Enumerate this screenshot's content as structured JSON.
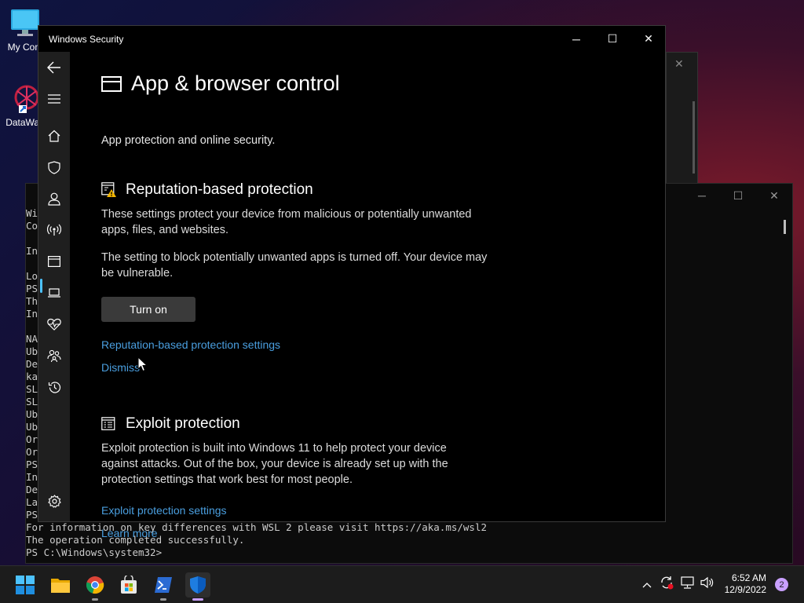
{
  "desktop": {
    "icons": [
      {
        "label": "My Com",
        "icon": "monitor-icon"
      },
      {
        "label": "DataWag",
        "icon": "datawag-icon"
      }
    ]
  },
  "powershell": {
    "lines": [
      "Wi",
      "Co",
      "",
      "In",
      "",
      "Lo",
      "PS",
      "Th",
      "In",
      "",
      "NA",
      "Ub",
      "De",
      "ka",
      "SL",
      "SL",
      "Ub",
      "Ub",
      "Or",
      "Or",
      "PS",
      "In",
      "De",
      "La",
      "PS",
      "For information on key differences with WSL 2 please visit https://aka.ms/wsl2",
      "The operation completed successfully.",
      "PS C:\\Windows\\system32>"
    ]
  },
  "window": {
    "title": "Windows Security",
    "minimize": "─",
    "maximize": "☐",
    "close": "✕"
  },
  "sidebar": {
    "items": [
      {
        "name": "back",
        "icon": "back-arrow-icon"
      },
      {
        "name": "menu",
        "icon": "hamburger-icon"
      },
      {
        "name": "home",
        "icon": "home-icon"
      },
      {
        "name": "virus-protection",
        "icon": "shield-icon"
      },
      {
        "name": "account-protection",
        "icon": "person-icon"
      },
      {
        "name": "firewall",
        "icon": "antenna-icon"
      },
      {
        "name": "app-browser-control",
        "icon": "browser-window-icon",
        "active": true
      },
      {
        "name": "device-security",
        "icon": "laptop-icon"
      },
      {
        "name": "device-performance",
        "icon": "heart-pulse-icon"
      },
      {
        "name": "family-options",
        "icon": "family-icon"
      },
      {
        "name": "protection-history",
        "icon": "history-icon"
      },
      {
        "name": "settings",
        "icon": "gear-icon"
      }
    ]
  },
  "content": {
    "title": "App & browser control",
    "subtitle": "App protection and online security.",
    "reputation": {
      "heading": "Reputation-based protection",
      "desc": "These settings protect your device from malicious or potentially unwanted apps, files, and websites.",
      "warning": "The setting to block potentially unwanted apps is turned off. Your device may be vulnerable.",
      "button": "Turn on",
      "settings_link": "Reputation-based protection settings",
      "dismiss_link": "Dismiss"
    },
    "exploit": {
      "heading": "Exploit protection",
      "desc": "Exploit protection is built into Windows 11 to help protect your device against attacks.  Out of the box, your device is already set up with the protection settings that work best for most people.",
      "settings_link": "Exploit protection settings",
      "learn_link": "Learn more"
    }
  },
  "taskbar": {
    "apps": [
      {
        "name": "start",
        "icon": "windows-logo-icon"
      },
      {
        "name": "file-explorer",
        "icon": "folder-icon"
      },
      {
        "name": "chrome",
        "icon": "chrome-icon"
      },
      {
        "name": "microsoft-store",
        "icon": "store-icon"
      },
      {
        "name": "powershell",
        "icon": "powershell-icon"
      },
      {
        "name": "windows-security",
        "icon": "security-shield-icon"
      }
    ],
    "time": "6:52 AM",
    "date": "12/9/2022",
    "notifications": "2"
  },
  "colors": {
    "link": "#4a9fe0",
    "accent": "#4cc2ff",
    "button": "#3a3a3a"
  }
}
